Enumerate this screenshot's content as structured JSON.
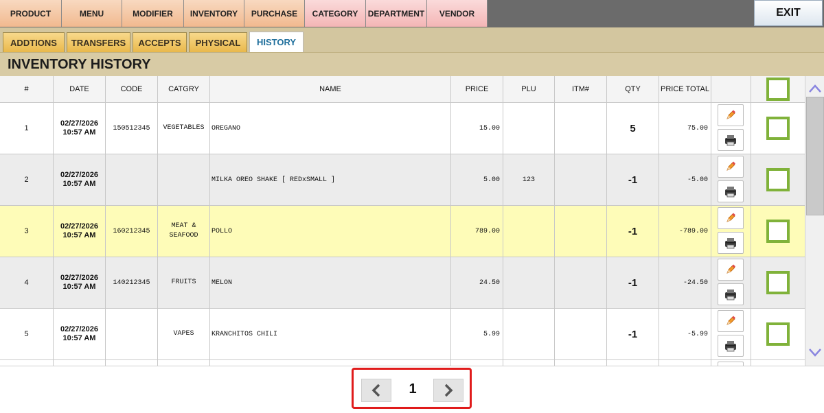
{
  "nav": {
    "items": [
      {
        "label": "PRODUCT"
      },
      {
        "label": "MENU"
      },
      {
        "label": "MODIFIER"
      },
      {
        "label": "INVENTORY"
      },
      {
        "label": "PURCHASE"
      },
      {
        "label": "CATEGORY"
      },
      {
        "label": "DEPARTMENT"
      },
      {
        "label": "VENDOR"
      }
    ],
    "exit_label": "EXIT"
  },
  "tabs": [
    {
      "label": "ADDTIONS"
    },
    {
      "label": "TRANSFERS"
    },
    {
      "label": "ACCEPTS"
    },
    {
      "label": "PHYSICAL"
    },
    {
      "label": "HISTORY",
      "active": true
    }
  ],
  "page_title": "INVENTORY HISTORY",
  "table": {
    "headers": [
      "#",
      "DATE",
      "CODE",
      "CATGRY",
      "NAME",
      "PRICE",
      "PLU",
      "ITM#",
      "QTY",
      "PRICE TOTAL"
    ],
    "rows": [
      {
        "num": "1",
        "date": "02/27/2026",
        "time": "10:57 AM",
        "code": "150512345",
        "cat1": "VEGETABLES",
        "cat2": "",
        "name": "OREGANO",
        "price": "15.00",
        "plu": "",
        "itm": "",
        "qty": "5",
        "total": "75.00"
      },
      {
        "num": "2",
        "date": "02/27/2026",
        "time": "10:57 AM",
        "code": "",
        "cat1": "",
        "cat2": "",
        "name": "MILKA OREO SHAKE [ REDxSMALL ]",
        "price": "5.00",
        "plu": "123",
        "itm": "",
        "qty": "-1",
        "total": "-5.00"
      },
      {
        "num": "3",
        "date": "02/27/2026",
        "time": "10:57 AM",
        "code": "160212345",
        "cat1": "MEAT &",
        "cat2": "SEAFOOD",
        "name": "POLLO",
        "price": "789.00",
        "plu": "",
        "itm": "",
        "qty": "-1",
        "total": "-789.00"
      },
      {
        "num": "4",
        "date": "02/27/2026",
        "time": "10:57 AM",
        "code": "140212345",
        "cat1": "FRUITS",
        "cat2": "",
        "name": "MELON",
        "price": "24.50",
        "plu": "",
        "itm": "",
        "qty": "-1",
        "total": "-24.50"
      },
      {
        "num": "5",
        "date": "02/27/2026",
        "time": "10:57 AM",
        "code": "",
        "cat1": "VAPES",
        "cat2": "",
        "name": "KRANCHITOS CHILI",
        "price": "5.99",
        "plu": "",
        "itm": "",
        "qty": "-1",
        "total": "-5.99"
      }
    ]
  },
  "pagination": {
    "current_page": "1"
  },
  "colors": {
    "highlight_row": "#fefcb8",
    "alt_row": "#ececec",
    "checkbox_border": "#80b23a",
    "active_tab_text": "#1f6f9c",
    "pager_outline": "#e01b1b"
  }
}
